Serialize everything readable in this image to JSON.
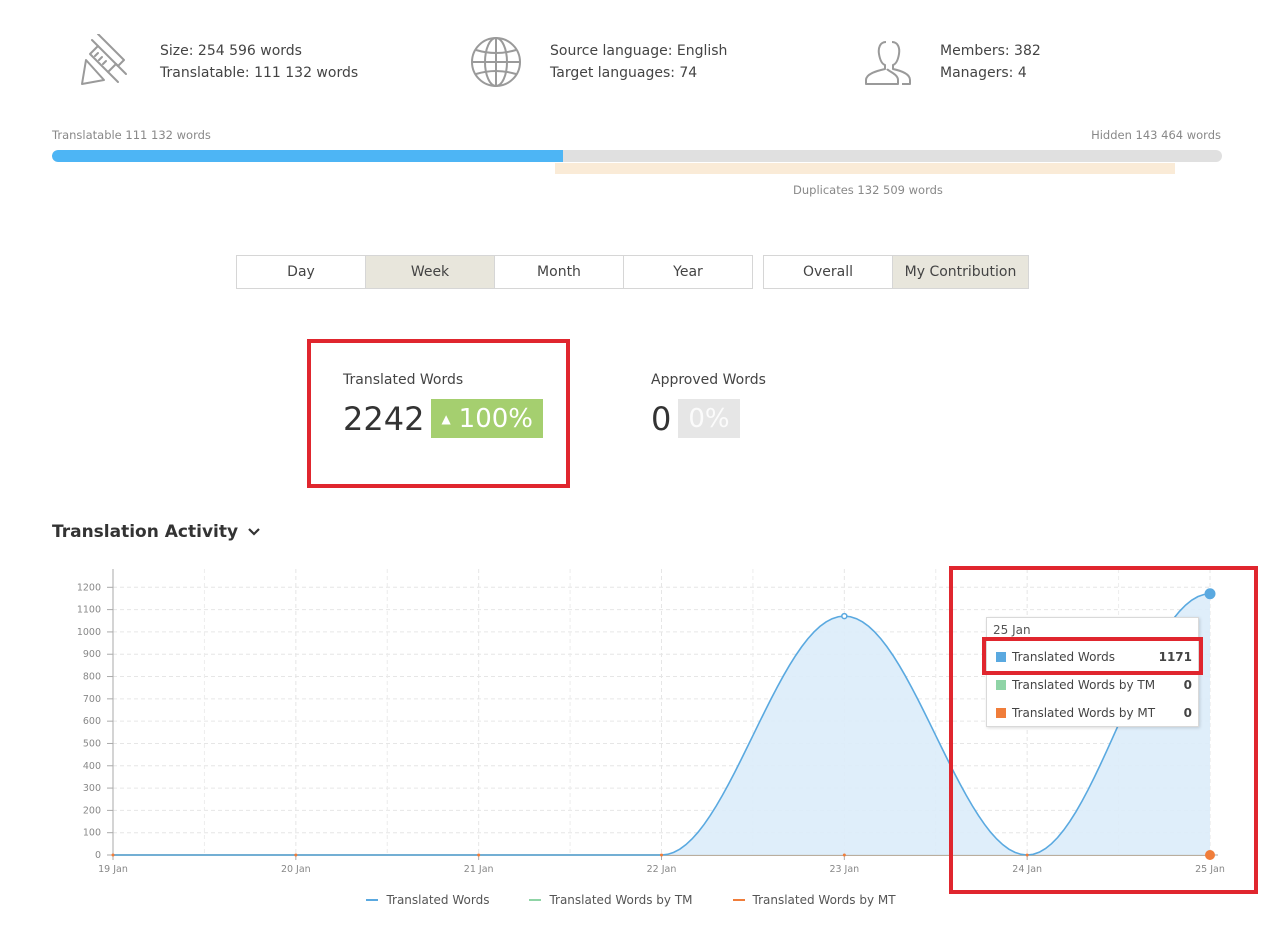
{
  "stats": {
    "size": "Size: 254 596 words",
    "translatable": "Translatable: 111 132 words",
    "source_language": "Source language: English",
    "target_languages": "Target languages: 74",
    "members": "Members: 382",
    "managers": "Managers: 4"
  },
  "progress": {
    "translatable_label": "Translatable 111 132 words",
    "hidden_label": "Hidden 143 464 words",
    "duplicates_label": "Duplicates 132 509 words",
    "translatable_fraction": 0.4365
  },
  "period_buttons": [
    "Day",
    "Week",
    "Month",
    "Year"
  ],
  "scope_buttons": [
    "Overall",
    "My Contribution"
  ],
  "active_period": "Week",
  "active_scope": "My Contribution",
  "metrics": {
    "translated": {
      "label": "Translated Words",
      "value": "2242",
      "change": "100%"
    },
    "approved": {
      "label": "Approved Words",
      "value": "0",
      "change": "0%"
    }
  },
  "section_title": "Translation Activity",
  "tooltip": {
    "date": "25 Jan",
    "rows": [
      {
        "name": "Translated Words",
        "value": "1171"
      },
      {
        "name": "Translated Words by TM",
        "value": "0"
      },
      {
        "name": "Translated Words by MT",
        "value": "0"
      }
    ]
  },
  "colors": {
    "translated": "#5aa9e0",
    "tm": "#8fd4a6",
    "mt": "#f07d3a",
    "progress": "#4db5f5",
    "badge_green": "#a5cf6f",
    "highlight": "#e0262e"
  },
  "chart_data": {
    "type": "area",
    "categories": [
      "19 Jan",
      "20 Jan",
      "21 Jan",
      "22 Jan",
      "23 Jan",
      "24 Jan",
      "25 Jan"
    ],
    "series": [
      {
        "name": "Translated Words",
        "values": [
          0,
          0,
          0,
          0,
          1071,
          0,
          1171
        ]
      },
      {
        "name": "Translated Words by TM",
        "values": [
          0,
          0,
          0,
          0,
          0,
          0,
          0
        ]
      },
      {
        "name": "Translated Words by MT",
        "values": [
          0,
          0,
          0,
          0,
          0,
          0,
          0
        ]
      }
    ],
    "y_ticks": [
      "0",
      "100",
      "200",
      "300",
      "400",
      "500",
      "600",
      "700",
      "800",
      "900",
      "1000",
      "1100",
      "1200"
    ],
    "ylim": [
      0,
      1300
    ],
    "grid": true,
    "legend_position": "bottom"
  }
}
